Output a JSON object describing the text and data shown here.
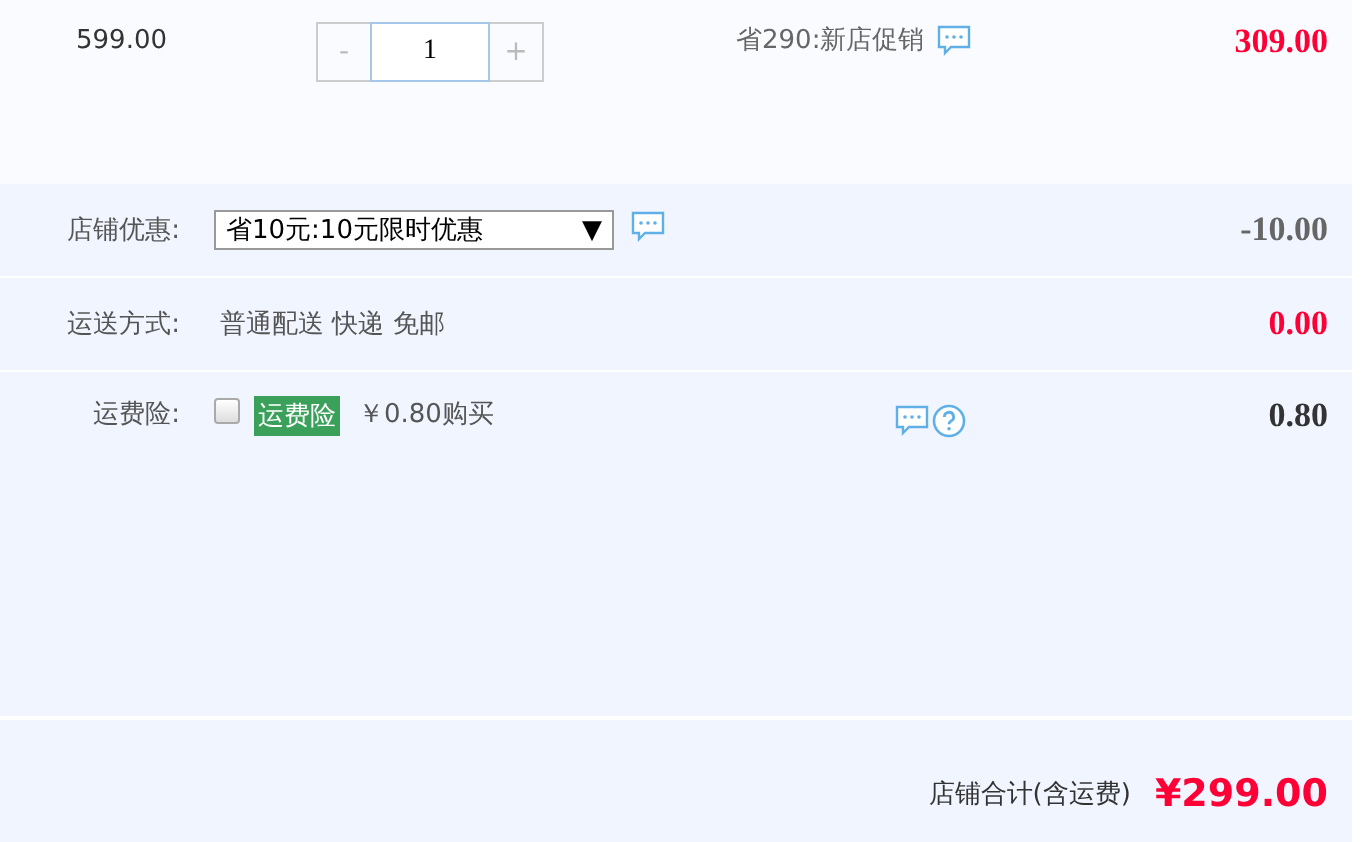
{
  "item": {
    "unit_price": "599.00",
    "minus": "-",
    "quantity": "1",
    "plus": "+",
    "promo": "省290:新店促销",
    "subtotal": "309.00"
  },
  "rows": [
    {
      "kind": "select",
      "label": "店铺优惠:",
      "value": "省10元:10元限时优惠",
      "caret": "▼",
      "amount": "-10.00",
      "color": "#666666"
    },
    {
      "kind": "text",
      "label": "运送方式:",
      "value": "普通配送 快递 免邮",
      "amount": "0.00",
      "color": "#ff0036"
    },
    {
      "kind": "insurance",
      "label": "运费险:",
      "checked": false,
      "tag": "运费险",
      "value": "￥0.80购买",
      "amount": "0.80",
      "color": "#333333"
    }
  ],
  "footer": {
    "label": "店铺合计(含运费)",
    "total": "¥299.00"
  }
}
